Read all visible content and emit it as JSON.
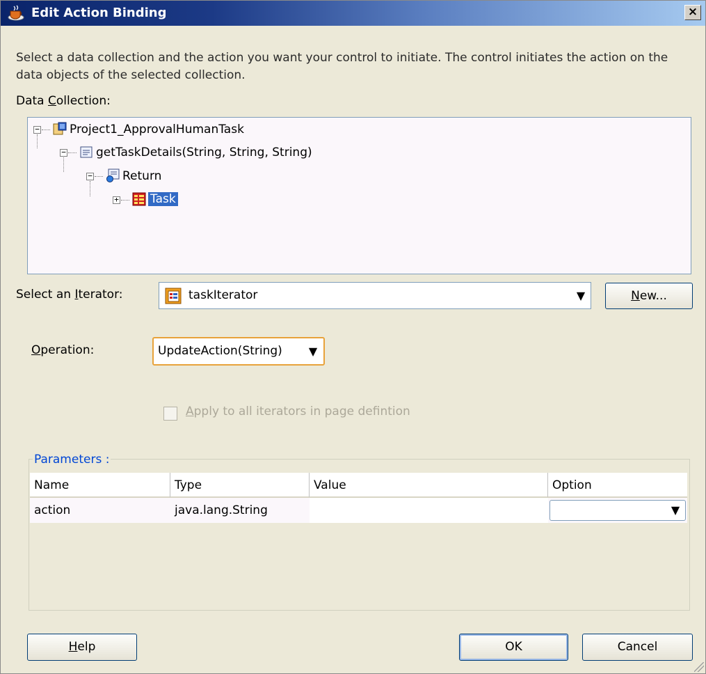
{
  "window": {
    "title": "Edit Action Binding",
    "close_glyph": "×"
  },
  "description": "Select a data collection and the action you want your control to initiate. The control initiates the action on the data objects of the selected collection.",
  "data_collection": {
    "label_pre": "Data ",
    "label_mnemonic": "C",
    "label_post": "ollection:",
    "tree": [
      {
        "label": "Project1_ApprovalHumanTask",
        "icon": "project-icon",
        "expander": "−"
      },
      {
        "label": "getTaskDetails(String, String, String)",
        "icon": "method-icon",
        "expander": "−"
      },
      {
        "label": "Return",
        "icon": "return-icon",
        "expander": "−"
      },
      {
        "label": "Task",
        "icon": "collection-icon",
        "expander": "+",
        "selected": true
      }
    ]
  },
  "iterator": {
    "label_pre": "Select an ",
    "label_mnemonic": "I",
    "label_post": "terator:",
    "value": "taskIterator",
    "icon": "iterator-icon",
    "new_button_mnemonic": "N",
    "new_button_rest": "ew..."
  },
  "operation": {
    "label_mnemonic": "O",
    "label_rest": "peration:",
    "value": "UpdateAction(String)"
  },
  "apply_all": {
    "label_mnemonic": "A",
    "label_rest": "pply to all iterators in page defintion",
    "checked": false,
    "enabled": false
  },
  "parameters": {
    "title": "Parameters :",
    "columns": [
      "Name",
      "Type",
      "Value",
      "Option"
    ],
    "rows": [
      {
        "name": "action",
        "type": "java.lang.String",
        "value": "",
        "option": ""
      }
    ]
  },
  "buttons": {
    "help_mnemonic": "H",
    "help_rest": "elp",
    "ok": "OK",
    "cancel": "Cancel"
  },
  "colors": {
    "selection": "#316ac5",
    "title_start": "#0a246a",
    "title_end": "#a6caf0",
    "group_title": "#0046d5"
  }
}
